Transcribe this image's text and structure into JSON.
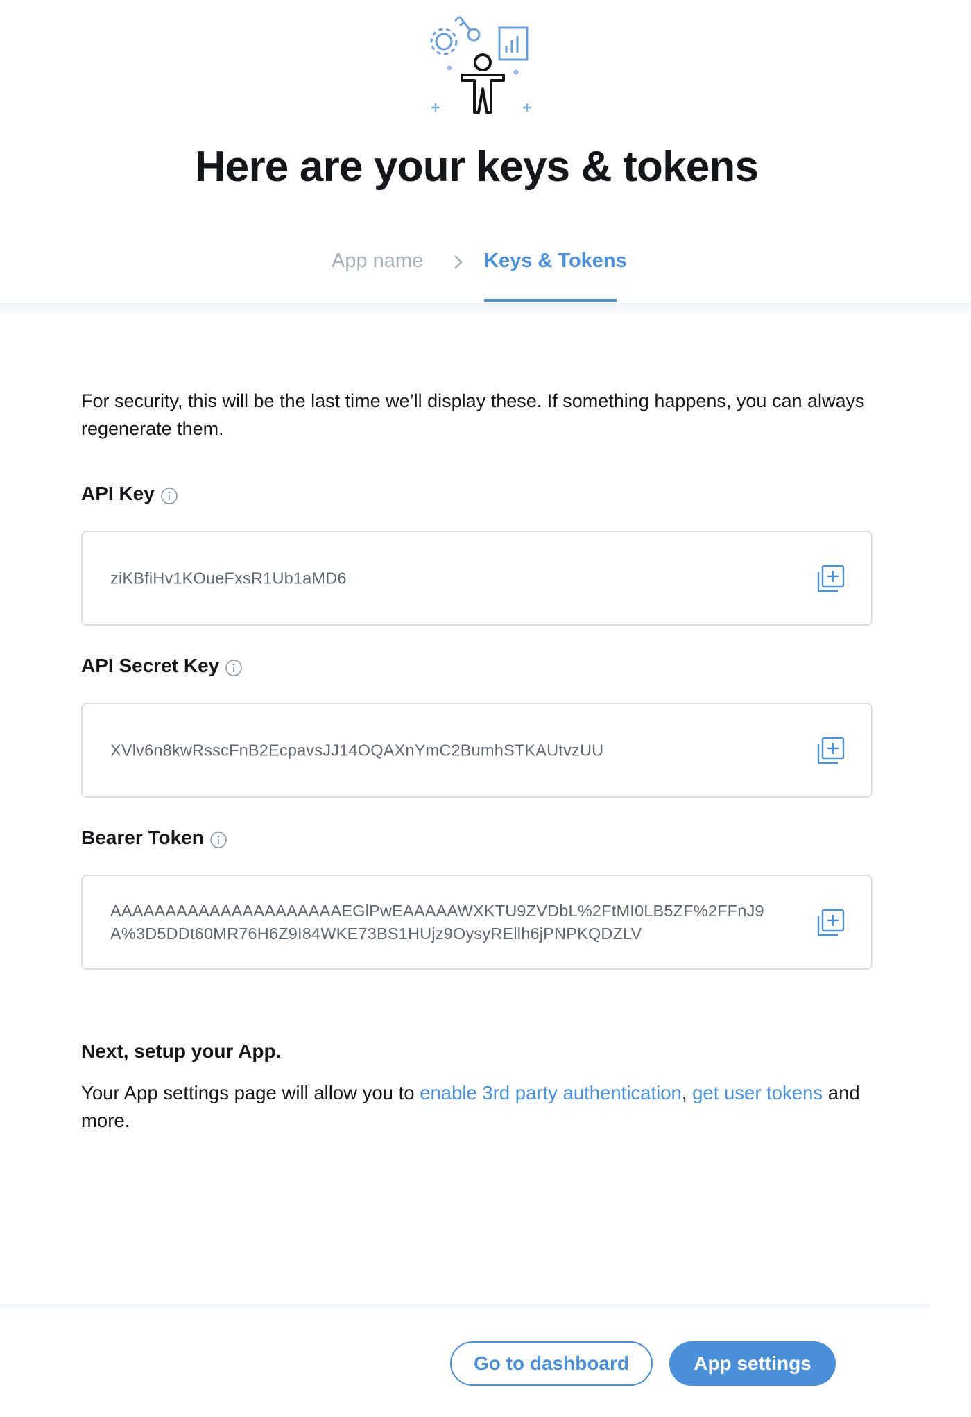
{
  "page": {
    "title": "Here are your keys & tokens"
  },
  "breadcrumb": {
    "step1": "App name",
    "step2": "Keys & Tokens"
  },
  "intro": "For security, this will be the last time we’ll display these. If something happens, you can always regenerate them.",
  "fields": [
    {
      "label": "API Key",
      "value": "ziKBfiHv1KOueFxsR1Ub1aMD6"
    },
    {
      "label": "API Secret Key",
      "value": "XVlv6n8kwRsscFnB2EcpavsJJ14OQAXnYmC2BumhSTKAUtvzUU"
    },
    {
      "label": "Bearer Token",
      "value": "AAAAAAAAAAAAAAAAAAAAAEGlPwEAAAAAWXKTU9ZVDbL%2FtMI0LB5ZF%2FFnJ9A%3D5DDt60MR76H6Z9I84WKE73BS1HUjz9OysyREllh6jPNPKQDZLV"
    }
  ],
  "next": {
    "title": "Next, setup your App.",
    "body_prefix": "Your App settings page will allow you to ",
    "link1": "enable 3rd party authentication",
    "separator": ", ",
    "link2": "get user tokens",
    "body_suffix": " and more."
  },
  "buttons": {
    "dashboard": "Go to dashboard",
    "settings": "App settings"
  },
  "colors": {
    "accent": "#4a8fd8",
    "muted": "#a4b0bb",
    "border": "#d8dfe5",
    "text": "#14171a"
  },
  "icons": {
    "hero": "developer-illustration",
    "info": "info-icon",
    "copy": "copy-plus-icon",
    "chevron": "chevron-right-icon"
  }
}
